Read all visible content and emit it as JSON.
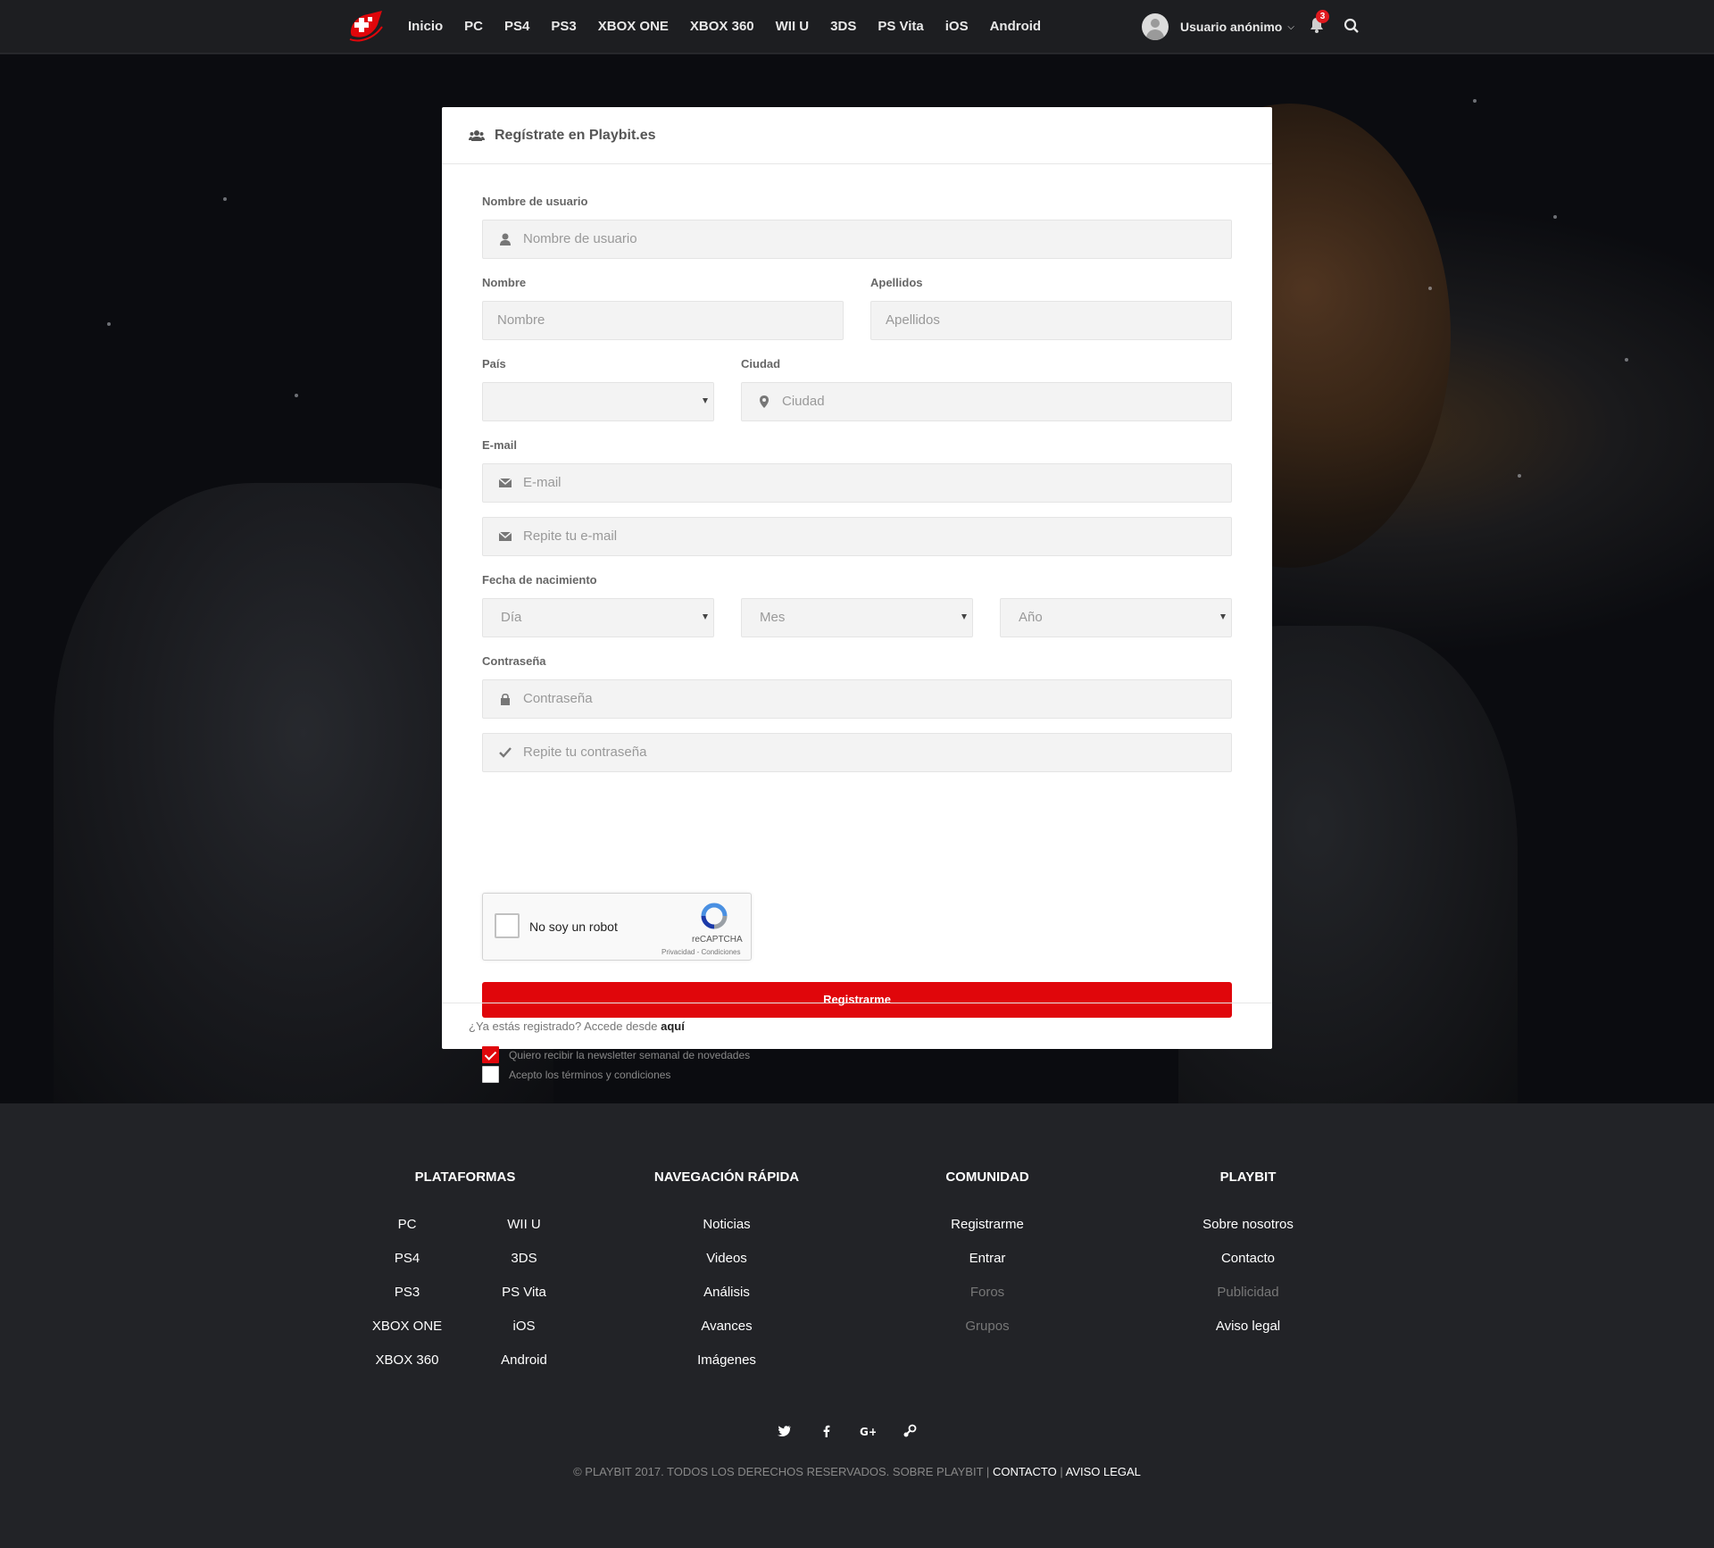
{
  "nav": {
    "links": [
      "Inicio",
      "PC",
      "PS4",
      "PS3",
      "XBOX ONE",
      "XBOX 360",
      "WII U",
      "3DS",
      "PS Vita",
      "iOS",
      "Android"
    ],
    "user_name": "Usuario anónimo",
    "notification_count": "3"
  },
  "form": {
    "title": "Regístrate en Playbit.es",
    "username_label": "Nombre de usuario",
    "username_placeholder": "Nombre de usuario",
    "first_name_label": "Nombre",
    "first_name_placeholder": "Nombre",
    "last_name_label": "Apellidos",
    "last_name_placeholder": "Apellidos",
    "country_label": "País",
    "country_value": "",
    "city_label": "Ciudad",
    "city_placeholder": "Ciudad",
    "email_label": "E-mail",
    "email_placeholder": "E-mail",
    "email_repeat_placeholder": "Repite tu e-mail",
    "birth_label": "Fecha de nacimiento",
    "day_value": "Día",
    "month_value": "Mes",
    "year_value": "Año",
    "password_label": "Contraseña",
    "password_placeholder": "Contraseña",
    "password_repeat_placeholder": "Repite tu contraseña",
    "captcha_label": "No soy un robot",
    "captcha_brand": "reCAPTCHA",
    "captcha_links": "Privacidad - Condiciones",
    "submit_label": "Registrarme",
    "newsletter_label": "Quiero recibir la newsletter semanal de novedades",
    "newsletter_checked": true,
    "terms_label": "Acepto los términos y condiciones",
    "terms_checked": false,
    "footer_text": "¿Ya estás registrado? Accede desde",
    "footer_link": "aquí"
  },
  "footer": {
    "platforms_title": "PLATAFORMAS",
    "platforms_col1": [
      "PC",
      "PS4",
      "PS3",
      "XBOX ONE",
      "XBOX 360"
    ],
    "platforms_col2": [
      "WII U",
      "3DS",
      "PS Vita",
      "iOS",
      "Android"
    ],
    "quicknav_title": "NAVEGACIÓN RÁPIDA",
    "quicknav": [
      "Noticias",
      "Videos",
      "Análisis",
      "Avances",
      "Imágenes"
    ],
    "community_title": "COMUNIDAD",
    "community": [
      "Registrarme",
      "Entrar",
      "Foros",
      "Grupos"
    ],
    "playbit_title": "PLAYBIT",
    "playbit": [
      "Sobre nosotros",
      "Contacto",
      "Publicidad",
      "Aviso legal"
    ],
    "social_icons": [
      "twitter-icon",
      "facebook-icon",
      "google-plus-icon",
      "steam-icon"
    ],
    "copyright": "© PLAYBIT 2017. TODOS LOS DERECHOS RESERVADOS. SOBRE PLAYBIT",
    "copyright_sep": "|",
    "contact": "CONTACTO",
    "legal": "AVISO LEGAL"
  },
  "colors": {
    "accent": "#e0060b",
    "nav_bg": "#1d1e21",
    "footer_bg": "#222327"
  }
}
